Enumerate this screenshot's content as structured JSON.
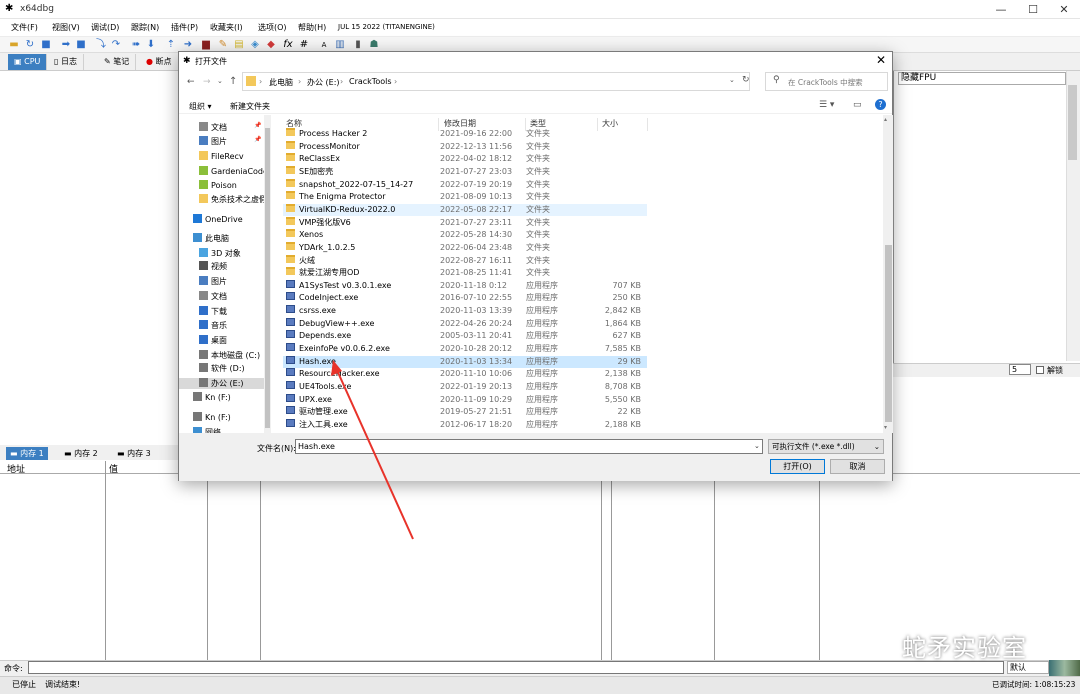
{
  "app": {
    "title": "x64dbg",
    "controls": [
      "—",
      "☐",
      "✕"
    ],
    "menus": [
      "文件(F)",
      "视图(V)",
      "调试(D)",
      "跟踪(N)",
      "插件(P)",
      "收藏夹(I)",
      "选项(O)",
      "帮助(H)",
      "JUL 15 2022 (TITANENGINE)"
    ],
    "tabs": [
      "CPU",
      "日志",
      "笔记",
      "断点"
    ],
    "fpu_label": "隐藏FPU",
    "args_value": "5",
    "lock_label": "解锁",
    "memory_tabs": [
      "内存 1",
      "内存 2",
      "内存 3"
    ],
    "dump_headers": [
      "地址",
      "值"
    ],
    "command_label": "命令:",
    "default_label": "默认",
    "status_left": "已停止",
    "status_msg": "调试结束!",
    "status_right": "已调试时间:  1:08:15:23",
    "watermark": "蛇矛实验室"
  },
  "dialog": {
    "title": "打开文件",
    "breadcrumb": [
      "此电脑",
      "办公 (E:)",
      "CrackTools"
    ],
    "search_placeholder": "在 CrackTools 中搜索",
    "organize": "组织 ▾",
    "new_folder": "新建文件夹",
    "nav": [
      {
        "label": "文档",
        "icon": "document-icon",
        "pinned": true
      },
      {
        "label": "图片",
        "icon": "picture-icon",
        "pinned": true
      },
      {
        "label": "FileRecv",
        "icon": "folder-icon"
      },
      {
        "label": "GardeniaCode",
        "icon": "shared-folder-icon"
      },
      {
        "label": "Poison",
        "icon": "shared-folder-icon"
      },
      {
        "label": "免杀技术之虚假",
        "icon": "folder-icon"
      },
      {
        "label": "OneDrive",
        "icon": "cloud-icon"
      },
      {
        "label": "此电脑",
        "icon": "computer-icon"
      },
      {
        "label": "3D 对象",
        "icon": "cube-icon"
      },
      {
        "label": "视频",
        "icon": "video-icon"
      },
      {
        "label": "图片",
        "icon": "picture-icon"
      },
      {
        "label": "文档",
        "icon": "document-icon"
      },
      {
        "label": "下载",
        "icon": "download-icon"
      },
      {
        "label": "音乐",
        "icon": "music-icon"
      },
      {
        "label": "桌面",
        "icon": "desktop-icon"
      },
      {
        "label": "本地磁盘 (C:)",
        "icon": "drive-icon"
      },
      {
        "label": "软件 (D:)",
        "icon": "drive-icon"
      },
      {
        "label": "办公 (E:)",
        "icon": "drive-icon",
        "selected": true
      },
      {
        "label": "Kn (F:)",
        "icon": "drive-icon"
      },
      {
        "label": "Kn (F:)",
        "icon": "drive-icon"
      },
      {
        "label": "网络",
        "icon": "network-icon"
      }
    ],
    "columns": [
      "名称",
      "修改日期",
      "类型",
      "大小"
    ],
    "files": [
      {
        "name": "Process Hacker 2",
        "date": "2021-09-16 22:00",
        "type": "文件夹",
        "size": "",
        "kind": "folder"
      },
      {
        "name": "ProcessMonitor",
        "date": "2022-12-13 11:56",
        "type": "文件夹",
        "size": "",
        "kind": "folder"
      },
      {
        "name": "ReClassEx",
        "date": "2022-04-02 18:12",
        "type": "文件夹",
        "size": "",
        "kind": "folder"
      },
      {
        "name": "SE加密壳",
        "date": "2021-07-27 23:03",
        "type": "文件夹",
        "size": "",
        "kind": "folder"
      },
      {
        "name": "snapshot_2022-07-15_14-27",
        "date": "2022-07-19 20:19",
        "type": "文件夹",
        "size": "",
        "kind": "folder"
      },
      {
        "name": "The Enigma Protector",
        "date": "2021-08-09 10:13",
        "type": "文件夹",
        "size": "",
        "kind": "folder"
      },
      {
        "name": "VirtualKD-Redux-2022.0",
        "date": "2022-05-08 22:17",
        "type": "文件夹",
        "size": "",
        "kind": "folder",
        "hover": true
      },
      {
        "name": "VMP强化版V6",
        "date": "2021-07-27 23:11",
        "type": "文件夹",
        "size": "",
        "kind": "folder"
      },
      {
        "name": "Xenos",
        "date": "2022-05-28 14:30",
        "type": "文件夹",
        "size": "",
        "kind": "folder"
      },
      {
        "name": "YDArk_1.0.2.5",
        "date": "2022-06-04 23:48",
        "type": "文件夹",
        "size": "",
        "kind": "folder"
      },
      {
        "name": "火绒",
        "date": "2022-08-27 16:11",
        "type": "文件夹",
        "size": "",
        "kind": "folder"
      },
      {
        "name": "就爱江湖专用OD",
        "date": "2021-08-25 11:41",
        "type": "文件夹",
        "size": "",
        "kind": "folder"
      },
      {
        "name": "A1SysTest v0.3.0.1.exe",
        "date": "2020-11-18 0:12",
        "type": "应用程序",
        "size": "707 KB",
        "kind": "exe"
      },
      {
        "name": "CodeInject.exe",
        "date": "2016-07-10 22:55",
        "type": "应用程序",
        "size": "250 KB",
        "kind": "exe"
      },
      {
        "name": "csrss.exe",
        "date": "2020-11-03 13:39",
        "type": "应用程序",
        "size": "2,842 KB",
        "kind": "exe"
      },
      {
        "name": "DebugView++.exe",
        "date": "2022-04-26 20:24",
        "type": "应用程序",
        "size": "1,864 KB",
        "kind": "exe"
      },
      {
        "name": "Depends.exe",
        "date": "2005-03-11 20:41",
        "type": "应用程序",
        "size": "627 KB",
        "kind": "exe"
      },
      {
        "name": "ExeinfoPe v0.0.6.2.exe",
        "date": "2020-10-28 20:12",
        "type": "应用程序",
        "size": "7,585 KB",
        "kind": "exe"
      },
      {
        "name": "Hash.exe",
        "date": "2020-11-03 13:34",
        "type": "应用程序",
        "size": "29 KB",
        "kind": "exe",
        "selected": true
      },
      {
        "name": "ResourceHacker.exe",
        "date": "2020-11-10 10:06",
        "type": "应用程序",
        "size": "2,138 KB",
        "kind": "exe"
      },
      {
        "name": "UE4Tools.exe",
        "date": "2022-01-19 20:13",
        "type": "应用程序",
        "size": "8,708 KB",
        "kind": "exe"
      },
      {
        "name": "UPX.exe",
        "date": "2020-11-09 10:29",
        "type": "应用程序",
        "size": "5,550 KB",
        "kind": "exe"
      },
      {
        "name": "驱动管理.exe",
        "date": "2019-05-27 21:51",
        "type": "应用程序",
        "size": "22 KB",
        "kind": "exe"
      },
      {
        "name": "注入工具.exe",
        "date": "2012-06-17 18:20",
        "type": "应用程序",
        "size": "2,188 KB",
        "kind": "exe"
      }
    ],
    "filename_label": "文件名(N):",
    "filename_value": "Hash.exe",
    "filetype_value": "可执行文件 (*.exe *.dll)",
    "open_button": "打开(O)",
    "cancel_button": "取消"
  },
  "colors": {
    "accent": "#3c7fc1",
    "selection": "#cce8ff",
    "arrow": "#e8332a"
  }
}
